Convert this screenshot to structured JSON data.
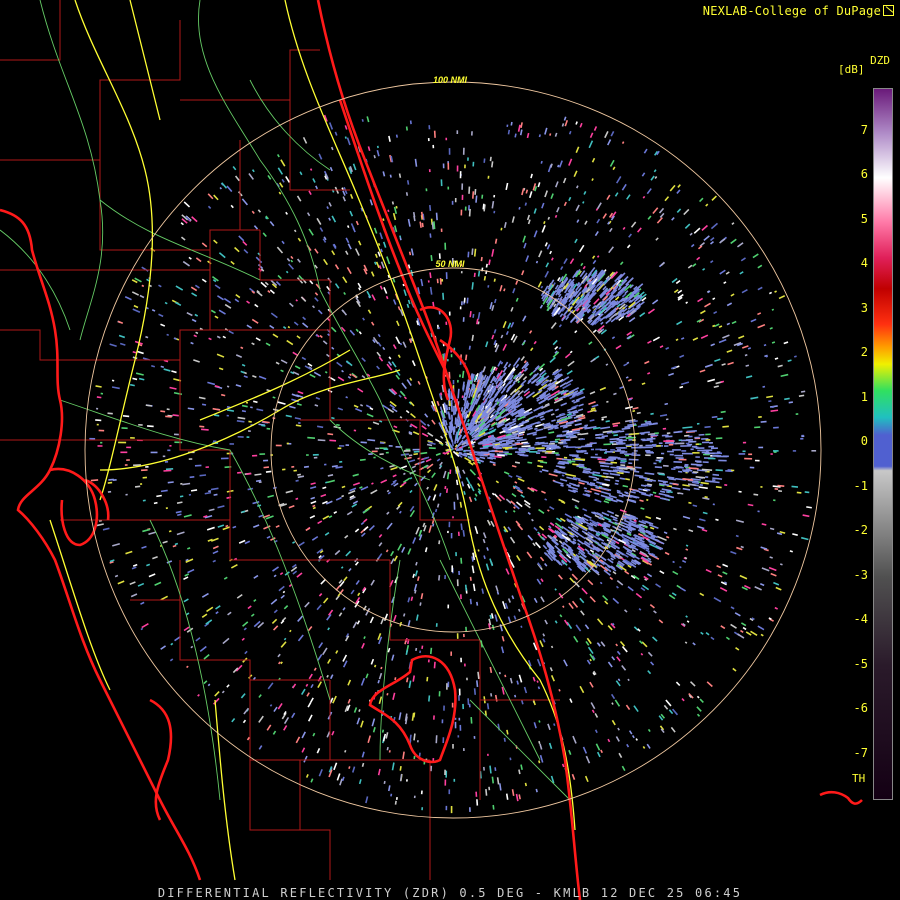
{
  "header": {
    "credit": "NEXLAB-College of DuPage"
  },
  "footer": {
    "product_line": "DIFFERENTIAL REFLECTIVITY (ZDR) 0.5 DEG - KMLB 12 DEC 25 06:45"
  },
  "map": {
    "range_rings": [
      {
        "label": "50 NMI",
        "range_nmi": 50
      },
      {
        "label": "100 NMI",
        "range_nmi": 100
      }
    ],
    "colors": {
      "background": "#000000",
      "coastline": "#ff1a1a",
      "county_lines": "#b01818",
      "highways": "#ffff33",
      "roads": "#66cc66",
      "range_rings": "#f0c8a0"
    }
  },
  "legend": {
    "title": "DZD",
    "unit": "[dB]",
    "ticks": [
      "7",
      "6",
      "5",
      "4",
      "3",
      "2",
      "1",
      "0",
      "-1",
      "-2",
      "-3",
      "-4",
      "-5",
      "-6",
      "-7"
    ],
    "threshold_label": "TH",
    "value_range": [
      -8,
      8
    ],
    "gradient": [
      {
        "value": 8,
        "color": "#6a1a7a"
      },
      {
        "value": 7,
        "color": "#b08cc8"
      },
      {
        "value": 6,
        "color": "#ffffff"
      },
      {
        "value": 5,
        "color": "#ff7aa8"
      },
      {
        "value": 4.2,
        "color": "#e0205a"
      },
      {
        "value": 3.5,
        "color": "#c00000"
      },
      {
        "value": 2.7,
        "color": "#ff3010"
      },
      {
        "value": 2.2,
        "color": "#ff9a00"
      },
      {
        "value": 1.8,
        "color": "#f0f000"
      },
      {
        "value": 1.2,
        "color": "#30e060"
      },
      {
        "value": 0.6,
        "color": "#20c0c0"
      },
      {
        "value": 0.2,
        "color": "#5060d0"
      },
      {
        "value": -0.5,
        "color": "#5060d0"
      },
      {
        "value": -0.6,
        "color": "#c8c8c8"
      },
      {
        "value": -3,
        "color": "#505050"
      },
      {
        "value": -5,
        "color": "#2a1a2a"
      },
      {
        "value": -8,
        "color": "#140014"
      }
    ]
  }
}
